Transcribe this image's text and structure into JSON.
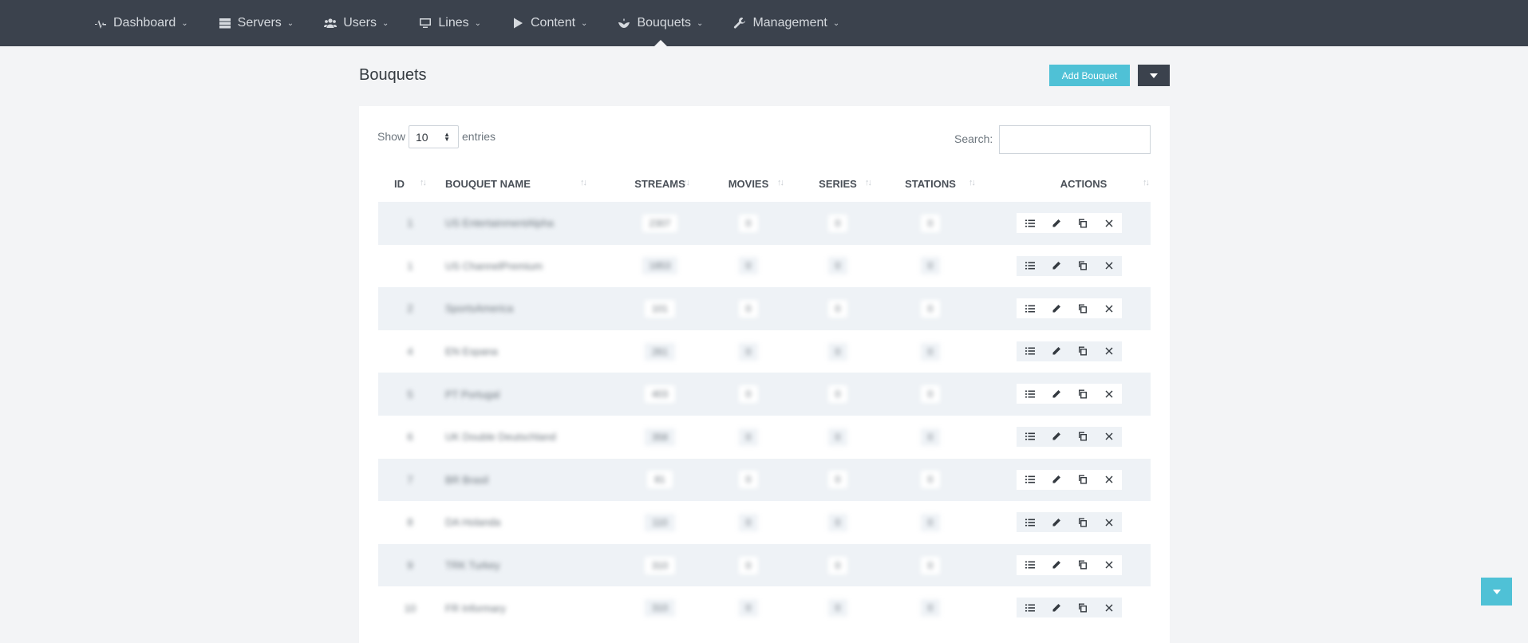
{
  "nav": [
    {
      "label": "Dashboard",
      "icon": "pulse-icon"
    },
    {
      "label": "Servers",
      "icon": "server-icon"
    },
    {
      "label": "Users",
      "icon": "users-icon"
    },
    {
      "label": "Lines",
      "icon": "monitor-icon"
    },
    {
      "label": "Content",
      "icon": "play-icon"
    },
    {
      "label": "Bouquets",
      "icon": "bouquet-icon"
    },
    {
      "label": "Management",
      "icon": "wrench-icon"
    }
  ],
  "header": {
    "title": "Bouquets",
    "add_label": "Add Bouquet"
  },
  "length": {
    "show_label": "Show",
    "value": "10",
    "entries_label": "entries"
  },
  "search": {
    "label": "Search:",
    "value": ""
  },
  "table": {
    "columns": [
      "ID",
      "BOUQUET NAME",
      "STREAMS",
      "MOVIES",
      "SERIES",
      "STATIONS",
      "ACTIONS"
    ],
    "rows": [
      {
        "id": "1",
        "name": "US EntertainmentAlpha",
        "streams": "2307",
        "movies": "0",
        "series": "0",
        "stations": "0"
      },
      {
        "id": "1",
        "name": "US ChannelPremium",
        "streams": "1853",
        "movies": "0",
        "series": "0",
        "stations": "0"
      },
      {
        "id": "2",
        "name": "SportsAmerica",
        "streams": "101",
        "movies": "0",
        "series": "0",
        "stations": "0"
      },
      {
        "id": "4",
        "name": "EN Espana",
        "streams": "261",
        "movies": "0",
        "series": "0",
        "stations": "0"
      },
      {
        "id": "5",
        "name": "PT Portugal",
        "streams": "403",
        "movies": "0",
        "series": "0",
        "stations": "0"
      },
      {
        "id": "6",
        "name": "UK Double Deutschland",
        "streams": "358",
        "movies": "0",
        "series": "0",
        "stations": "0"
      },
      {
        "id": "7",
        "name": "BR Brasil",
        "streams": "81",
        "movies": "0",
        "series": "0",
        "stations": "0"
      },
      {
        "id": "8",
        "name": "DA Holanda",
        "streams": "110",
        "movies": "0",
        "series": "0",
        "stations": "0"
      },
      {
        "id": "9",
        "name": "TRK Turkey",
        "streams": "310",
        "movies": "0",
        "series": "0",
        "stations": "0"
      },
      {
        "id": "10",
        "name": "FR Informary",
        "streams": "310",
        "movies": "0",
        "series": "0",
        "stations": "0"
      }
    ]
  },
  "colors": {
    "navbar": "#3b424d",
    "accent": "#4fc1d6",
    "row_stripe": "#eef2f6"
  }
}
